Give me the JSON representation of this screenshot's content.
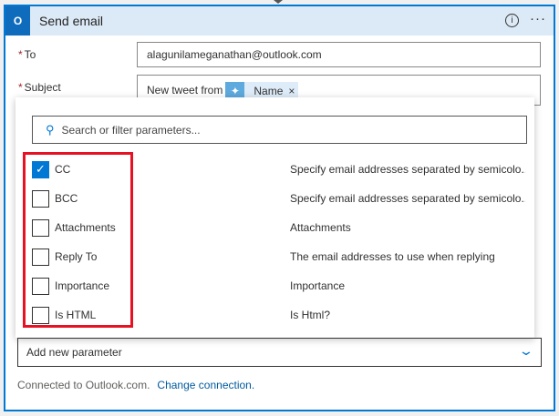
{
  "header": {
    "title": "Send email",
    "logo_text": "O",
    "info_icon": "i",
    "more_icon": "···"
  },
  "fields": {
    "to": {
      "label": "To",
      "required": "*",
      "value": "alagunilameganathan@outlook.com"
    },
    "subject": {
      "label": "Subject",
      "required": "*",
      "prefix": "New tweet from",
      "token": "Name",
      "token_remove": "×"
    }
  },
  "dropdown": {
    "search_placeholder": "Search or filter parameters...",
    "items": [
      {
        "name": "CC",
        "checked": true,
        "desc": "Specify email addresses separated by semicolo..."
      },
      {
        "name": "BCC",
        "checked": false,
        "desc": "Specify email addresses separated by semicolo..."
      },
      {
        "name": "Attachments",
        "checked": false,
        "desc": "Attachments"
      },
      {
        "name": "Reply To",
        "checked": false,
        "desc": "The email addresses to use when replying"
      },
      {
        "name": "Importance",
        "checked": false,
        "desc": "Importance"
      },
      {
        "name": "Is HTML",
        "checked": false,
        "desc": "Is Html?"
      }
    ]
  },
  "add_param": {
    "label": "Add new parameter"
  },
  "footer": {
    "text": "Connected to Outlook.com.",
    "link": "Change connection."
  },
  "colors": {
    "accent": "#0078d4",
    "highlight": "#e81123"
  }
}
